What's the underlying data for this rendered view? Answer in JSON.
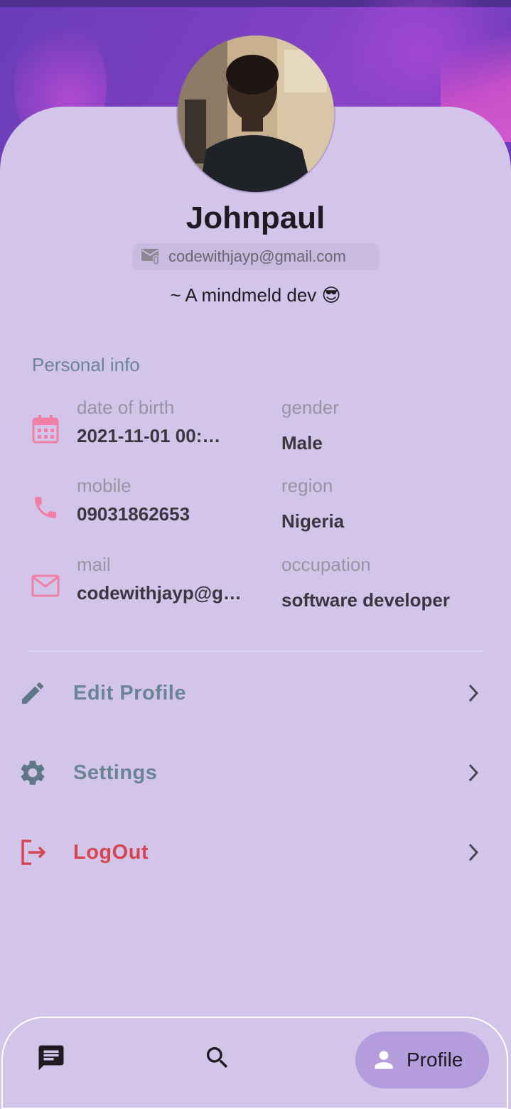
{
  "profile": {
    "name": "Johnpaul",
    "email": "codewithjayp@gmail.com",
    "bio": "~ A mindmeld dev 😎"
  },
  "personal_info": {
    "title": "Personal info",
    "dob_label": "date of birth",
    "dob_value": "2021-11-01 00:…",
    "gender_label": "gender",
    "gender_value": "Male",
    "mobile_label": "mobile",
    "mobile_value": "09031862653",
    "region_label": "region",
    "region_value": "Nigeria",
    "mail_label": "mail",
    "mail_value": "codewithjayp@g…",
    "occupation_label": "occupation",
    "occupation_value": "software developer"
  },
  "menu": {
    "edit_label": "Edit Profile",
    "settings_label": "Settings",
    "logout_label": "LogOut"
  },
  "nav": {
    "profile_label": "Profile",
    "icons": [
      "chat-icon",
      "search-icon",
      "person-icon"
    ]
  },
  "colors": {
    "accent": "#f07fa8",
    "muted_blue": "#6b8596",
    "logout": "#d64550",
    "nav_active": "#b59cdc",
    "background": "#d2c5e9"
  }
}
